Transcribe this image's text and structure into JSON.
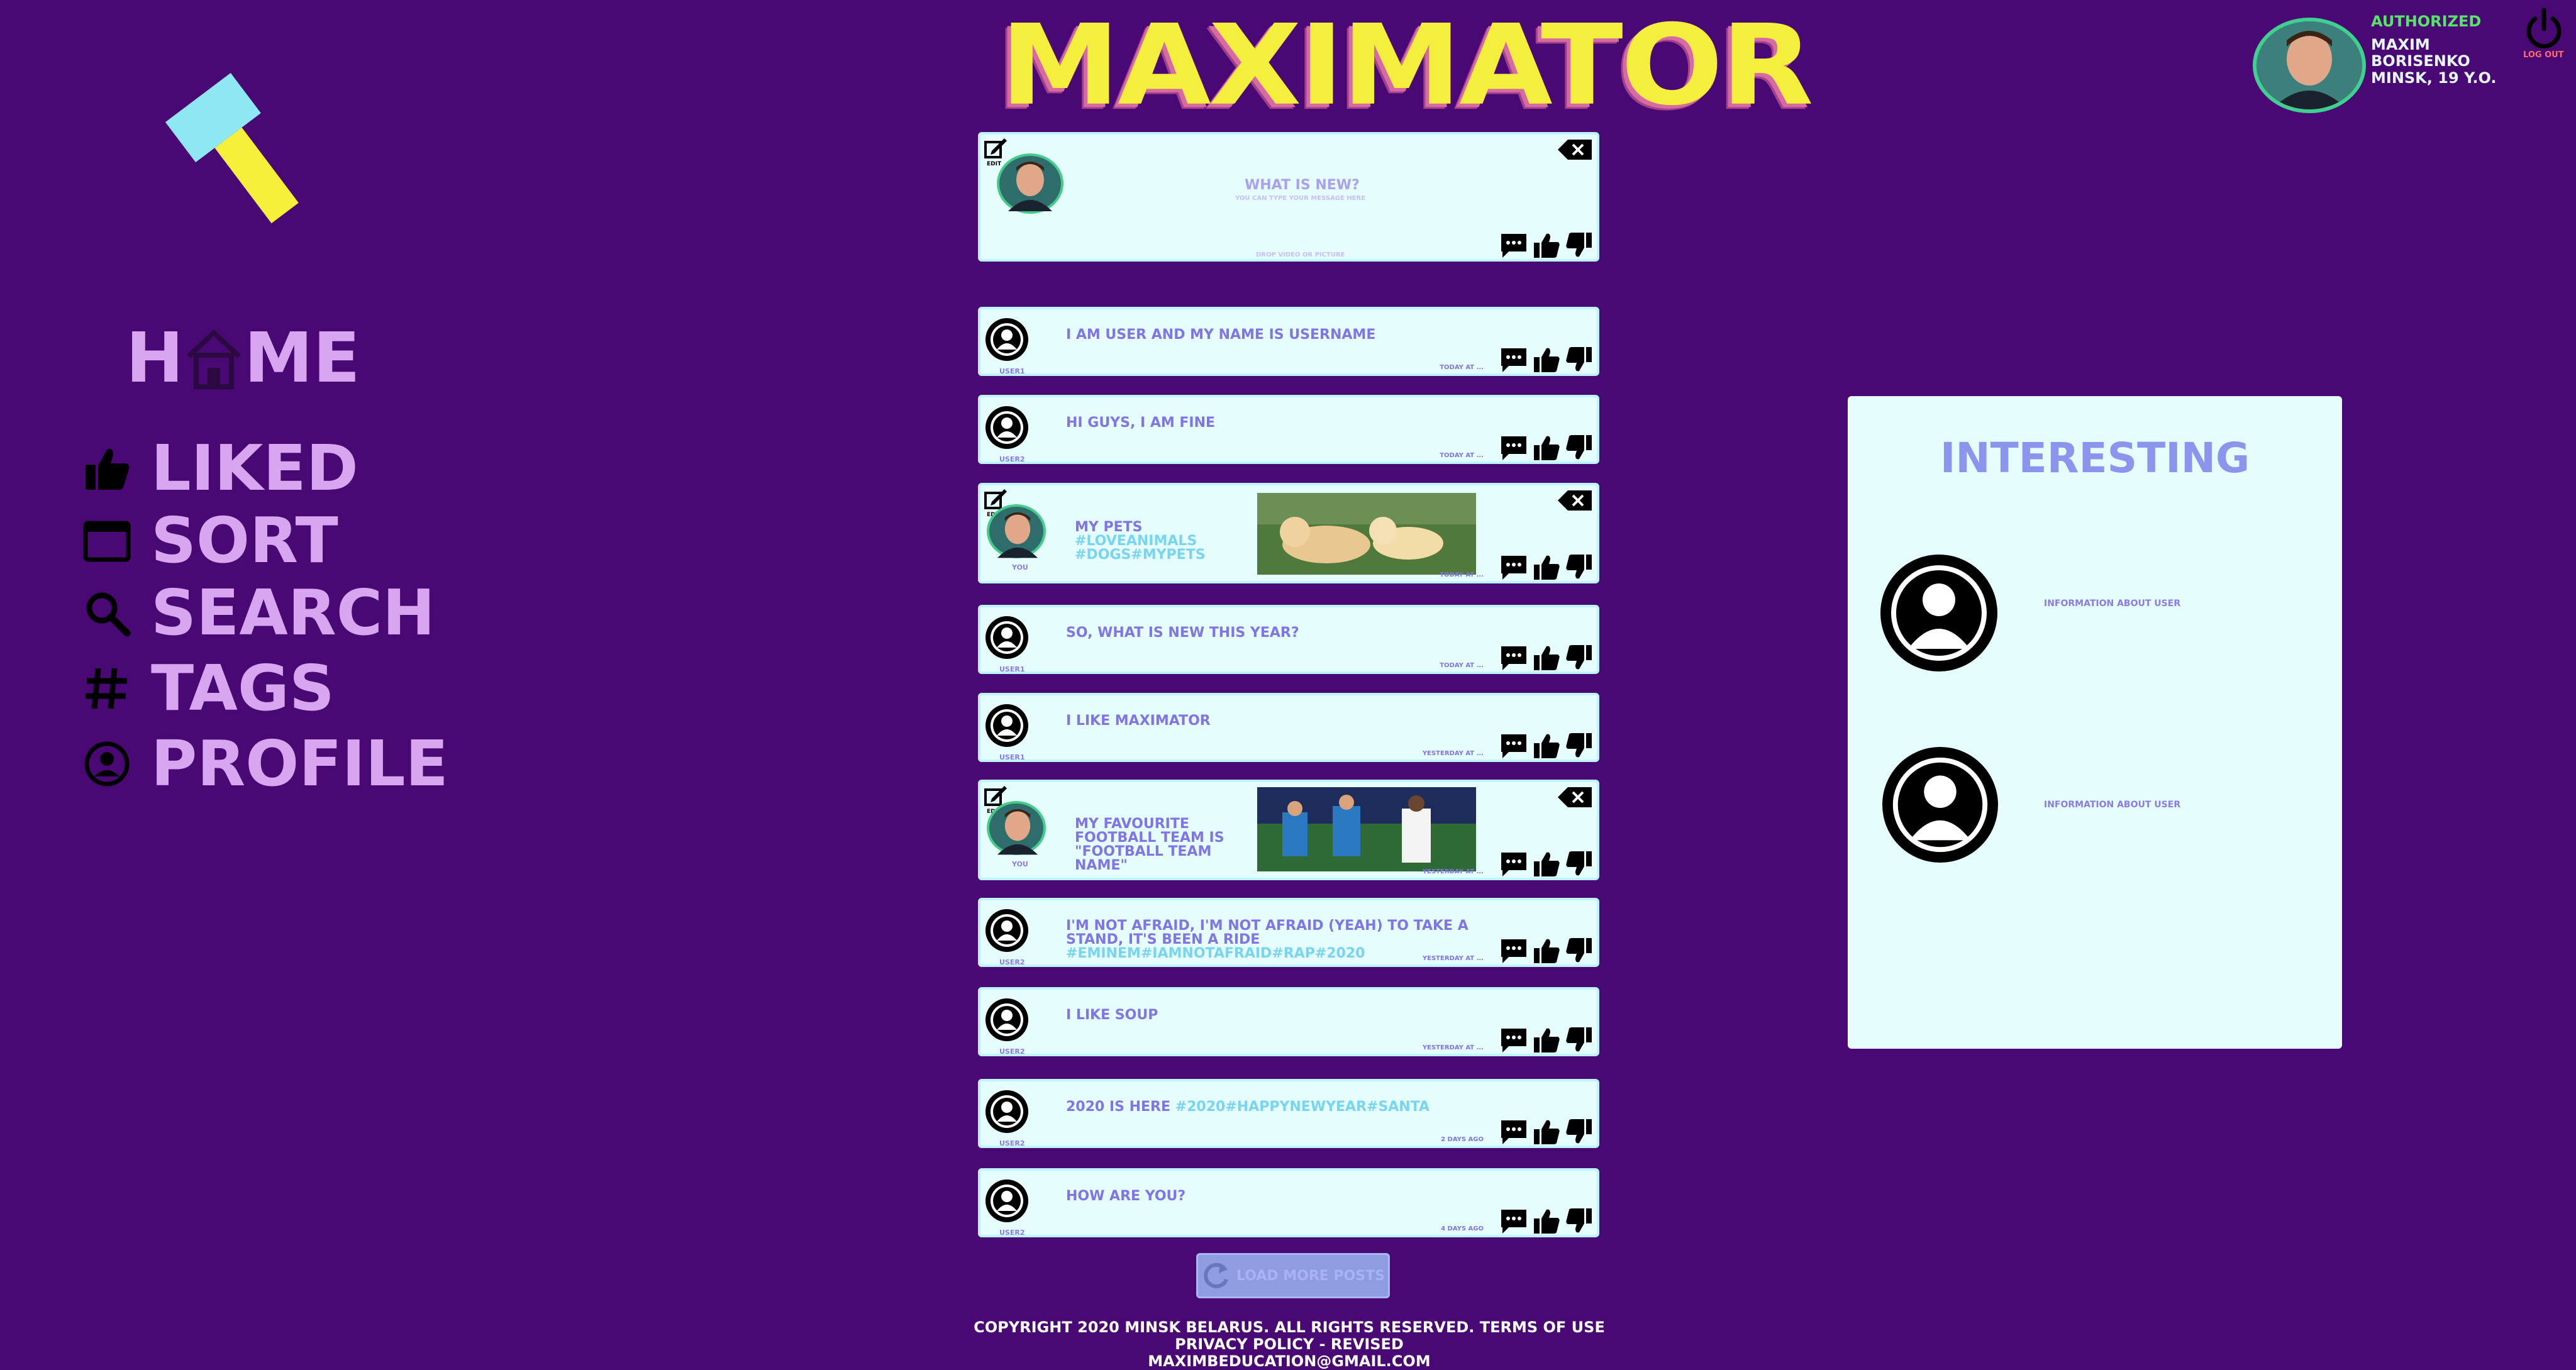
{
  "app": {
    "logo_text": "MAXIMATOR"
  },
  "nav": {
    "home": {
      "label_prefix": "H",
      "label_suffix": "ME"
    },
    "items": [
      {
        "label": "LIKED",
        "icon": "thumbs-up-icon"
      },
      {
        "label": "SORT",
        "icon": "window-icon"
      },
      {
        "label": "SEARCH",
        "icon": "search-icon"
      },
      {
        "label": "TAGS",
        "icon": "hash-icon"
      },
      {
        "label": "PROFILE",
        "icon": "profile-icon"
      }
    ]
  },
  "user": {
    "status": "AUTHORIZED",
    "name": "MAXIM BORISENKO",
    "info": "MINSK, 19 Y.O.",
    "logout_label": "LOG OUT"
  },
  "new_post": {
    "edit_label": "EDIT",
    "title": "WHAT  IS NEW?",
    "subtitle": "YOU CAN TYPE YOUR MESSAGE HERE",
    "drop": "DROP VIDEO OR PICTURE"
  },
  "posts": [
    {
      "name": "USER1",
      "text": "I AM USER AND MY NAME IS USERNAME",
      "tags": "",
      "time": "TODAY AT ..."
    },
    {
      "name": "USER2",
      "text": "HI GUYS, I AM FINE",
      "tags": "",
      "time": "TODAY AT ..."
    },
    {
      "name": "YOU",
      "text": "MY PETS ",
      "tags": "#LOVEANIMALS #DOGS#MYPETS",
      "time": "TODAY AT ...",
      "edit_label": "EDIT"
    },
    {
      "name": "USER1",
      "text": "SO, WHAT IS NEW THIS YEAR?",
      "tags": "",
      "time": "TODAY AT ..."
    },
    {
      "name": "USER1",
      "text": "I LIKE MAXIMATOR",
      "tags": "",
      "time": "YESTERDAY AT ..."
    },
    {
      "name": "YOU",
      "text": "MY FAVOURITE FOOTBALL TEAM IS \"FOOTBALL TEAM NAME\"",
      "tags": "",
      "time": "YESTERDAY AT ...",
      "edit_label": "EDIT"
    },
    {
      "name": "USER2",
      "text": "I'M NOT AFRAID, I'M NOT AFRAID (YEAH) TO TAKE A STAND, IT'S BEEN A RIDE ",
      "tags": "#EMINEM#IAMNOTAFRAID#RAP#2020",
      "time": "YESTERDAY AT ..."
    },
    {
      "name": "USER2",
      "text": "I LIKE SOUP",
      "tags": "",
      "time": "YESTERDAY AT ..."
    },
    {
      "name": "USER2",
      "text": "2020 IS HERE ",
      "tags": "#2020#HAPPYNEWYEAR#SANTA",
      "time": "2 DAYS AGO"
    },
    {
      "name": "USER2",
      "text": "HOW ARE YOU?",
      "tags": "",
      "time": "4 DAYS AGO"
    }
  ],
  "load_more": "LOAD MORE POSTS",
  "footer": {
    "line1": "COPYRIGHT 2020 MINSK BELARUS. ALL RIGHTS RESERVED. TERMS OF USE PRIVACY POLICY - REVISED",
    "line2": "MAXIMBEDUCATION@GMAIL.COM"
  },
  "interesting": {
    "title": "INTERESTING",
    "users": [
      {
        "info": "INFORMATION ABOUT USER"
      },
      {
        "info": "INFORMATION ABOUT USER"
      }
    ]
  }
}
